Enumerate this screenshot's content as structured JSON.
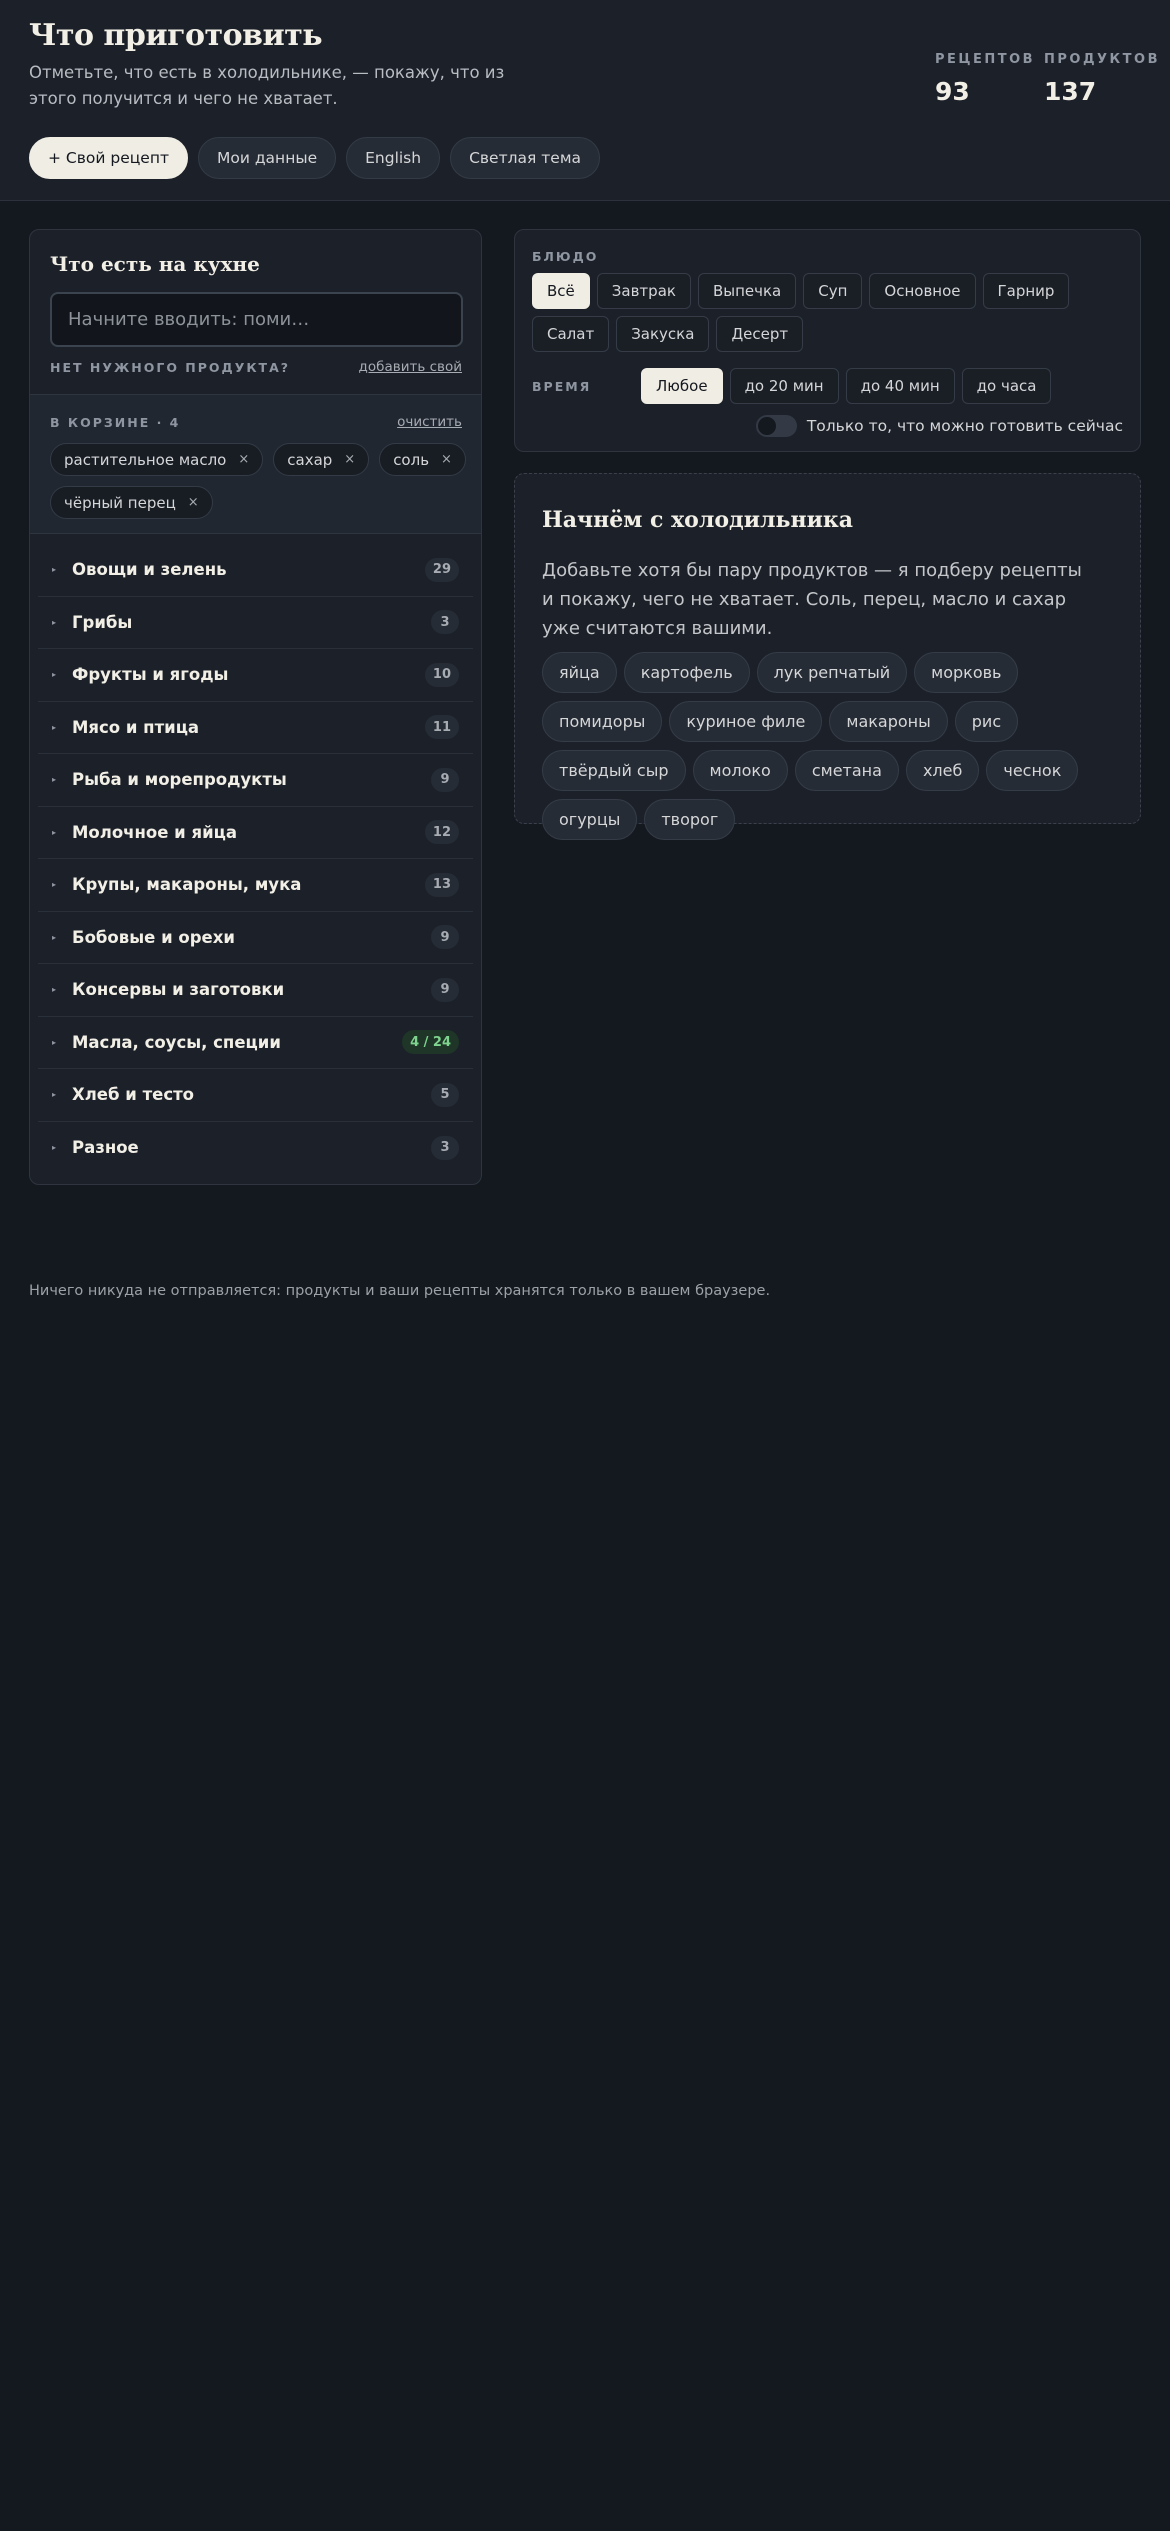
{
  "header": {
    "title": "Что приготовить",
    "subtitle": "Отметьте, что есть в холодильнике, — покажу, что из этого получится и чего не хватает.",
    "stats": [
      {
        "label": "РЕЦЕПТОВ",
        "value": "93"
      },
      {
        "label": "ПРОДУКТОВ",
        "value": "137"
      }
    ],
    "buttons": {
      "add_recipe": "+ Свой рецепт",
      "my_data": "Мои данные",
      "language": "English",
      "theme": "Светлая тема"
    }
  },
  "kitchen": {
    "title": "Что есть на кухне",
    "search_placeholder": "Начните вводить: поми…",
    "missing_label": "НЕТ НУЖНОГО ПРОДУКТА?",
    "add_own_link": "добавить свой",
    "basket_label": "В КОРЗИНЕ · 4",
    "clear_link": "очистить",
    "basket_items": [
      "растительное масло",
      "сахар",
      "соль",
      "чёрный перец"
    ],
    "remove_glyph": "×",
    "arrow_glyph": "▸",
    "categories": [
      {
        "label": "Овощи и зелень",
        "count": "29"
      },
      {
        "label": "Грибы",
        "count": "3"
      },
      {
        "label": "Фрукты и ягоды",
        "count": "10"
      },
      {
        "label": "Мясо и птица",
        "count": "11"
      },
      {
        "label": "Рыба и морепродукты",
        "count": "9"
      },
      {
        "label": "Молочное и яйца",
        "count": "12"
      },
      {
        "label": "Крупы, макароны, мука",
        "count": "13"
      },
      {
        "label": "Бобовые и орехи",
        "count": "9"
      },
      {
        "label": "Консервы и заготовки",
        "count": "9"
      },
      {
        "label": "Масла, соусы, специи",
        "count": "4 / 24"
      },
      {
        "label": "Хлеб и тесто",
        "count": "5"
      },
      {
        "label": "Разное",
        "count": "3"
      }
    ]
  },
  "filters": {
    "dish_label": "БЛЮДО",
    "dish_options": [
      "Всё",
      "Завтрак",
      "Выпечка",
      "Суп",
      "Основное",
      "Гарнир",
      "Салат",
      "Закуска",
      "Десерт"
    ],
    "dish_selected": "Всё",
    "time_label": "ВРЕМЯ",
    "time_options": [
      "Любое",
      "до 20 мин",
      "до 40 мин",
      "до часа"
    ],
    "time_selected": "Любое",
    "toggle_label": "Только то, что можно готовить сейчас",
    "toggle_on": false
  },
  "empty_state": {
    "title": "Начнём с холодильника",
    "text": "Добавьте хотя бы пару продуктов — я подберу рецепты и покажу, чего не хватает. Соль, перец, масло и сахар уже считаются вашими.",
    "suggestions": [
      "яйца",
      "картофель",
      "лук репчатый",
      "морковь",
      "помидоры",
      "куриное филе",
      "макароны",
      "рис",
      "твёрдый сыр",
      "молоко",
      "сметана",
      "хлеб",
      "чеснок",
      "огурцы",
      "творог"
    ]
  },
  "footer": {
    "text": "Ничего никуда не отправляется: продукты и ваши рецепты хранятся только в вашем браузере."
  },
  "colors": {
    "background": "#14181f",
    "panel": "#1c2129",
    "accent_light": "#efede4",
    "highlight_green": "#7ed38e"
  }
}
